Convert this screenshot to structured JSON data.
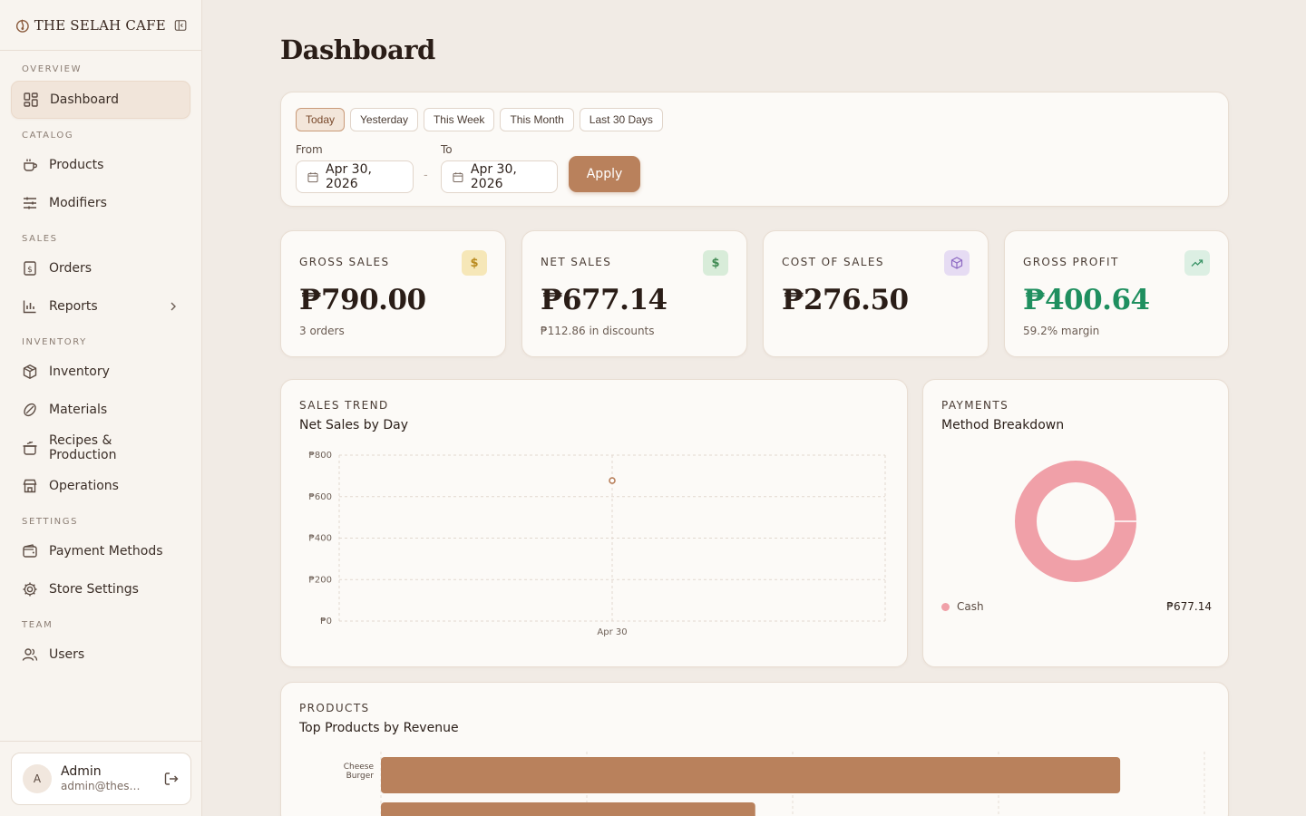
{
  "brand": {
    "name": "THE SELAH CAFE"
  },
  "sidebar": {
    "sections": {
      "overview": "OVERVIEW",
      "catalog": "CATALOG",
      "sales": "SALES",
      "inventory": "INVENTORY",
      "settings": "SETTINGS",
      "team": "TEAM"
    },
    "items": {
      "dashboard": "Dashboard",
      "products": "Products",
      "modifiers": "Modifiers",
      "orders": "Orders",
      "reports": "Reports",
      "inventory": "Inventory",
      "materials": "Materials",
      "recipes": "Recipes & Production",
      "operations": "Operations",
      "payment_methods": "Payment Methods",
      "store_settings": "Store Settings",
      "users": "Users"
    },
    "user": {
      "initial": "A",
      "name": "Admin",
      "email": "admin@these..."
    }
  },
  "page": {
    "title": "Dashboard"
  },
  "filters": {
    "ranges": [
      "Today",
      "Yesterday",
      "This Week",
      "This Month",
      "Last 30 Days"
    ],
    "active_range": "Today",
    "from_label": "From",
    "to_label": "To",
    "from_value": "Apr 30, 2026",
    "to_value": "Apr 30, 2026",
    "separator": "-",
    "apply_label": "Apply"
  },
  "kpis": {
    "gross_sales": {
      "label": "Gross Sales",
      "value": "₱790.00",
      "sub": "3 orders",
      "badge": "$",
      "color": "#f6e7b8"
    },
    "net_sales": {
      "label": "Net Sales",
      "value": "₱677.14",
      "sub": "₱112.86 in discounts",
      "badge": "$",
      "color": "#d8ecd9"
    },
    "cost_of_sales": {
      "label": "Cost of Sales",
      "value": "₱276.50",
      "sub": "",
      "badge": "box",
      "color": "#e6dcf3"
    },
    "gross_profit": {
      "label": "Gross Profit",
      "value": "₱400.64",
      "sub": "59.2% margin",
      "badge": "trend",
      "color": "#dcefe3"
    }
  },
  "sales_trend": {
    "label": "SALES TREND",
    "title": "Net Sales by Day"
  },
  "payments": {
    "label": "PAYMENTS",
    "title": "Method Breakdown",
    "methods": [
      {
        "name": "Cash",
        "value": "₱677.14",
        "color": "#f0a0a8"
      }
    ]
  },
  "products": {
    "label": "PRODUCTS",
    "title": "Top Products by Revenue"
  },
  "chart_data": [
    {
      "type": "line",
      "title": "Net Sales by Day",
      "x": [
        "Apr 30"
      ],
      "series": [
        {
          "values": [
            677.14
          ]
        }
      ],
      "y_ticks": [
        "₱800",
        "₱600",
        "₱400",
        "₱200",
        "₱0"
      ],
      "ylim": [
        0,
        800
      ],
      "grid": true,
      "accent": "#b9815c"
    },
    {
      "type": "pie",
      "title": "Method Breakdown",
      "categories": [
        "Cash"
      ],
      "values": [
        677.14
      ],
      "colors": [
        "#f0a0a8"
      ]
    },
    {
      "type": "bar",
      "title": "Top Products by Revenue",
      "categories": [
        "Cheese Burger",
        ""
      ],
      "values": [
        395,
        200
      ],
      "color": "#b9815c"
    }
  ]
}
